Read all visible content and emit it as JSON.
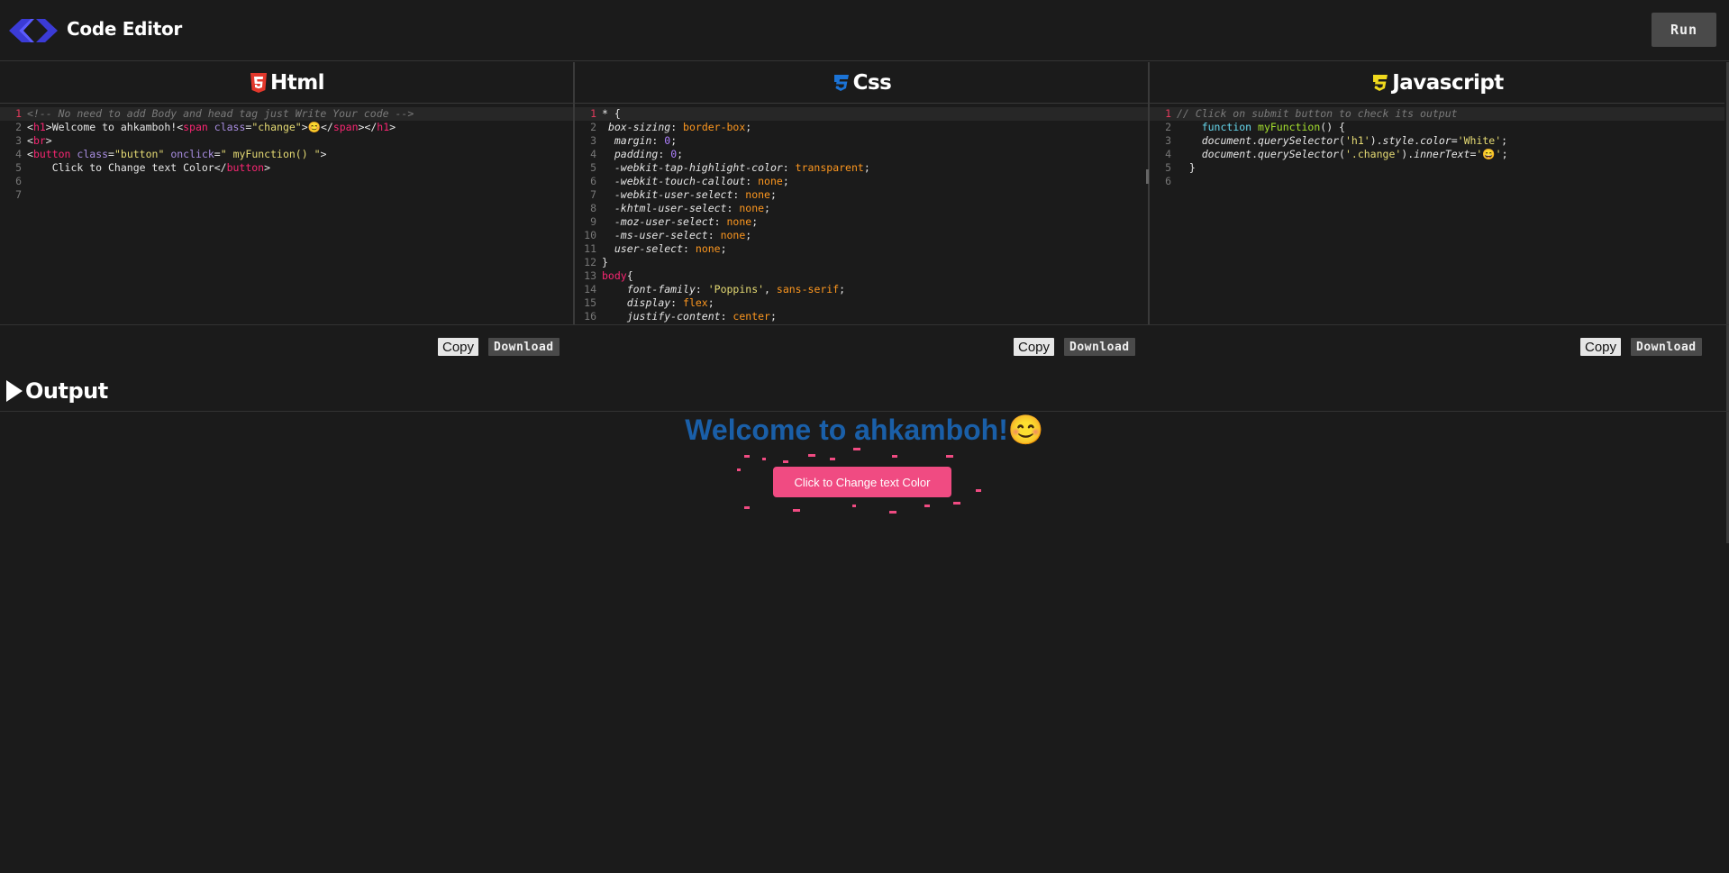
{
  "app": {
    "title": "Code Editor",
    "run_label": "Run"
  },
  "panels": [
    {
      "title": "Html",
      "icon": "html5-icon",
      "accent": "#e2382c",
      "copy_label": "Copy",
      "download_label": "Download",
      "lines": [
        [
          {
            "t": "<!-- No need to add Body and head tag just Write Your code -->",
            "c": "com"
          }
        ],
        [
          {
            "t": "<"
          },
          {
            "t": "h1",
            "c": "tag"
          },
          {
            "t": ">Welcome to ahkamboh!<"
          },
          {
            "t": "span",
            "c": "tag"
          },
          {
            "t": " "
          },
          {
            "t": "class",
            "c": "attr"
          },
          {
            "t": "="
          },
          {
            "t": "\"change\"",
            "c": "str"
          },
          {
            "t": ">😊</"
          },
          {
            "t": "span",
            "c": "tag"
          },
          {
            "t": "></"
          },
          {
            "t": "h1",
            "c": "tag"
          },
          {
            "t": ">"
          }
        ],
        [
          {
            "t": "<"
          },
          {
            "t": "br",
            "c": "tag"
          },
          {
            "t": ">"
          }
        ],
        [
          {
            "t": "<"
          },
          {
            "t": "button",
            "c": "tag"
          },
          {
            "t": " "
          },
          {
            "t": "class",
            "c": "attr"
          },
          {
            "t": "="
          },
          {
            "t": "\"button\"",
            "c": "str"
          },
          {
            "t": " "
          },
          {
            "t": "onclick",
            "c": "attr"
          },
          {
            "t": "="
          },
          {
            "t": "\" myFunction() \"",
            "c": "str"
          },
          {
            "t": ">"
          }
        ],
        [
          {
            "t": "    Click to Change text Color</"
          },
          {
            "t": "button",
            "c": "tag"
          },
          {
            "t": ">"
          }
        ],
        [
          {
            "t": ""
          }
        ],
        [
          {
            "t": ""
          }
        ]
      ]
    },
    {
      "title": "Css",
      "icon": "css3-icon",
      "accent": "#1b73d6",
      "copy_label": "Copy",
      "download_label": "Download",
      "lines": [
        [
          {
            "t": "* {"
          }
        ],
        [
          {
            "t": " "
          },
          {
            "t": "box-sizing",
            "c": "prop"
          },
          {
            "t": ": "
          },
          {
            "t": "border-box",
            "c": "val"
          },
          {
            "t": ";"
          }
        ],
        [
          {
            "t": "  "
          },
          {
            "t": "margin",
            "c": "prop"
          },
          {
            "t": ": "
          },
          {
            "t": "0",
            "c": "num"
          },
          {
            "t": ";"
          }
        ],
        [
          {
            "t": "  "
          },
          {
            "t": "padding",
            "c": "prop"
          },
          {
            "t": ": "
          },
          {
            "t": "0",
            "c": "num"
          },
          {
            "t": ";"
          }
        ],
        [
          {
            "t": "  "
          },
          {
            "t": "-webkit-tap-highlight-color",
            "c": "prop"
          },
          {
            "t": ": "
          },
          {
            "t": "transparent",
            "c": "val"
          },
          {
            "t": ";"
          }
        ],
        [
          {
            "t": "  "
          },
          {
            "t": "-webkit-touch-callout",
            "c": "prop"
          },
          {
            "t": ": "
          },
          {
            "t": "none",
            "c": "val"
          },
          {
            "t": ";"
          }
        ],
        [
          {
            "t": "  "
          },
          {
            "t": "-webkit-user-select",
            "c": "prop"
          },
          {
            "t": ": "
          },
          {
            "t": "none",
            "c": "val"
          },
          {
            "t": ";"
          }
        ],
        [
          {
            "t": "  "
          },
          {
            "t": "-khtml-user-select",
            "c": "prop"
          },
          {
            "t": ": "
          },
          {
            "t": "none",
            "c": "val"
          },
          {
            "t": ";"
          }
        ],
        [
          {
            "t": "  "
          },
          {
            "t": "-moz-user-select",
            "c": "prop"
          },
          {
            "t": ": "
          },
          {
            "t": "none",
            "c": "val"
          },
          {
            "t": ";"
          }
        ],
        [
          {
            "t": "  "
          },
          {
            "t": "-ms-user-select",
            "c": "prop"
          },
          {
            "t": ": "
          },
          {
            "t": "none",
            "c": "val"
          },
          {
            "t": ";"
          }
        ],
        [
          {
            "t": "  "
          },
          {
            "t": "user-select",
            "c": "prop"
          },
          {
            "t": ": "
          },
          {
            "t": "none",
            "c": "val"
          },
          {
            "t": ";"
          }
        ],
        [
          {
            "t": "}"
          }
        ],
        [
          {
            "t": "body",
            "c": "tag"
          },
          {
            "t": "{"
          }
        ],
        [
          {
            "t": "    "
          },
          {
            "t": "font-family",
            "c": "prop"
          },
          {
            "t": ": "
          },
          {
            "t": "'Poppins'",
            "c": "str"
          },
          {
            "t": ", "
          },
          {
            "t": "sans-serif",
            "c": "val"
          },
          {
            "t": ";"
          }
        ],
        [
          {
            "t": "    "
          },
          {
            "t": "display",
            "c": "prop"
          },
          {
            "t": ": "
          },
          {
            "t": "flex",
            "c": "val"
          },
          {
            "t": ";"
          }
        ],
        [
          {
            "t": "    "
          },
          {
            "t": "justify-content",
            "c": "prop"
          },
          {
            "t": ": "
          },
          {
            "t": "center",
            "c": "val"
          },
          {
            "t": ";"
          }
        ]
      ]
    },
    {
      "title": "Javascript",
      "icon": "javascript-icon",
      "accent": "#f0d91d",
      "copy_label": "Copy",
      "download_label": "Download",
      "lines": [
        [
          {
            "t": "// Click on submit button to check its output",
            "c": "com"
          }
        ],
        [
          {
            "t": "    "
          },
          {
            "t": "function",
            "c": "kw"
          },
          {
            "t": " "
          },
          {
            "t": "myFunction",
            "c": "fn"
          },
          {
            "t": "() {"
          }
        ],
        [
          {
            "t": "    "
          },
          {
            "t": "document",
            "c": "prop"
          },
          {
            "t": "."
          },
          {
            "t": "querySelector",
            "c": "prop"
          },
          {
            "t": "("
          },
          {
            "t": "'h1'",
            "c": "str"
          },
          {
            "t": ")."
          },
          {
            "t": "style",
            "c": "prop"
          },
          {
            "t": "."
          },
          {
            "t": "color",
            "c": "prop"
          },
          {
            "t": "="
          },
          {
            "t": "'White'",
            "c": "str"
          },
          {
            "t": ";"
          }
        ],
        [
          {
            "t": "    "
          },
          {
            "t": "document",
            "c": "prop"
          },
          {
            "t": "."
          },
          {
            "t": "querySelector",
            "c": "prop"
          },
          {
            "t": "("
          },
          {
            "t": "'.change'",
            "c": "str"
          },
          {
            "t": ")."
          },
          {
            "t": "innerText",
            "c": "prop"
          },
          {
            "t": "="
          },
          {
            "t": "'😄'",
            "c": "str"
          },
          {
            "t": ";"
          }
        ],
        [
          {
            "t": "  }"
          }
        ],
        [
          {
            "t": ""
          }
        ]
      ]
    }
  ],
  "output": {
    "title": "Output",
    "heading": "Welcome to ahkamboh!😊",
    "button_label": "Click to Change text Color",
    "accent": "#f04b82",
    "heading_color": "#1a5fa8"
  }
}
